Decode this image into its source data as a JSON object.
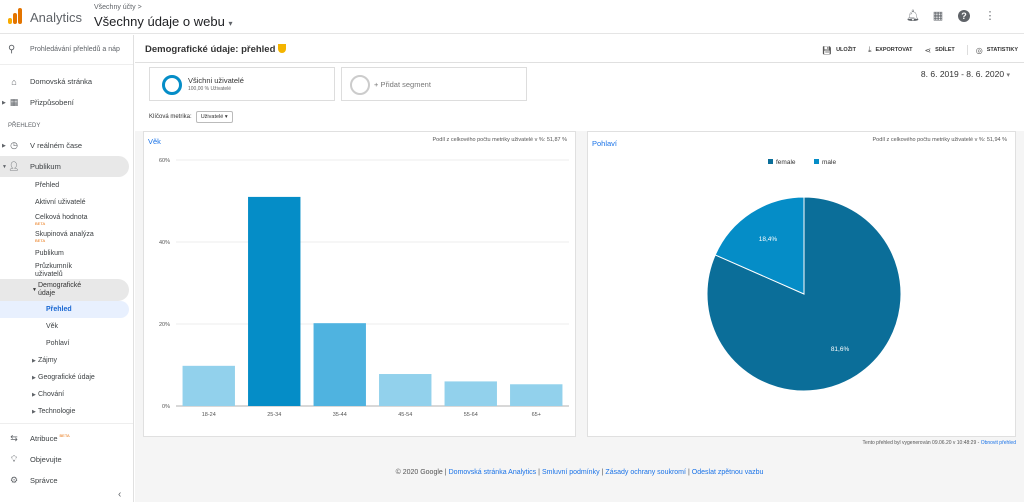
{
  "app": {
    "name": "Analytics",
    "account_crumb": "Všechny účty >",
    "property": "Všechny údaje o webu"
  },
  "topbar_icons": [
    "bell-icon",
    "apps-grid-icon",
    "help-icon",
    "more-vert-icon"
  ],
  "sidebar": {
    "search_placeholder": "Prohledávání přehledů a náp",
    "home": "Domovská stránka",
    "customization": "Přizpůsobení",
    "reports_label": "PŘEHLEDY",
    "realtime": "V reálném čase",
    "audience": "Publikum",
    "audience_items": {
      "overview": "Přehled",
      "active_users": "Aktivní uživatelé",
      "lifetime_value": "Celková hodnota",
      "cohort": "Skupinová analýza",
      "audiences": "Publikum",
      "user_explorer_1": "Průzkumník",
      "user_explorer_2": "uživatelů",
      "demographics_1": "Demografické",
      "demographics_2": "údaje",
      "demo_overview": "Přehled",
      "demo_age": "Věk",
      "demo_gender": "Pohlaví",
      "interests": "Zájmy",
      "geo": "Geografické údaje",
      "behavior": "Chování",
      "technology": "Technologie"
    },
    "beta": "BETA",
    "attribution": "Atribuce",
    "discover": "Objevujte",
    "admin": "Správce"
  },
  "report": {
    "title": "Demografické údaje: přehled",
    "toolbar": {
      "save": "ULOŽIT",
      "export": "EXPORTOVAT",
      "share": "SDÍLET",
      "insights": "STATISTIKY"
    },
    "segment": {
      "name": "Všichni uživatelé",
      "pct": "100,00 % Uživatelé",
      "add": "+ Přidat segment"
    },
    "date_range": "8. 6. 2019 - 8. 6. 2020",
    "metric_label": "Klíčová metrika:",
    "metric_value": "Uživatelé",
    "generated": "Tento přehled byl vygenerován 09.06.20 v 10:48:29 - ",
    "refresh": "Obnovit přehled"
  },
  "age_panel": {
    "title": "Věk",
    "note": "Podíl z celkového počtu metriky uživatelé v %: 51,87 %"
  },
  "gender_panel": {
    "title": "Pohlaví",
    "note": "Podíl z celkového počtu metriky uživatelé v %: 51,94 %"
  },
  "colors": {
    "accent": "#1a73e8",
    "bar_main": "#058dc7",
    "bar_light": "#92d1ec",
    "bar_mid": "#4fb3e0",
    "pie_female": "#0b6e99",
    "pie_male": "#058dc7"
  },
  "chart_data": [
    {
      "type": "bar",
      "title": "Věk",
      "categories": [
        "18-24",
        "25-34",
        "35-44",
        "45-54",
        "55-64",
        "65+"
      ],
      "values": [
        9.8,
        51.0,
        20.2,
        7.8,
        6.0,
        5.3
      ],
      "y_ticks": [
        "60%",
        "40%",
        "20%",
        "0%"
      ],
      "ylim": [
        0,
        60
      ],
      "grid": true
    },
    {
      "type": "pie",
      "title": "Pohlaví",
      "labels": [
        "female",
        "male"
      ],
      "values": [
        81.6,
        18.4
      ],
      "data_labels": [
        "81,6%",
        "18,4%"
      ],
      "legend": "top"
    }
  ],
  "footer": {
    "copyright": "© 2020 Google",
    "links": [
      "Domovská stránka Analytics",
      "Smluvní podmínky",
      "Zásady ochrany soukromí",
      "Odeslat zpětnou vazbu"
    ]
  }
}
